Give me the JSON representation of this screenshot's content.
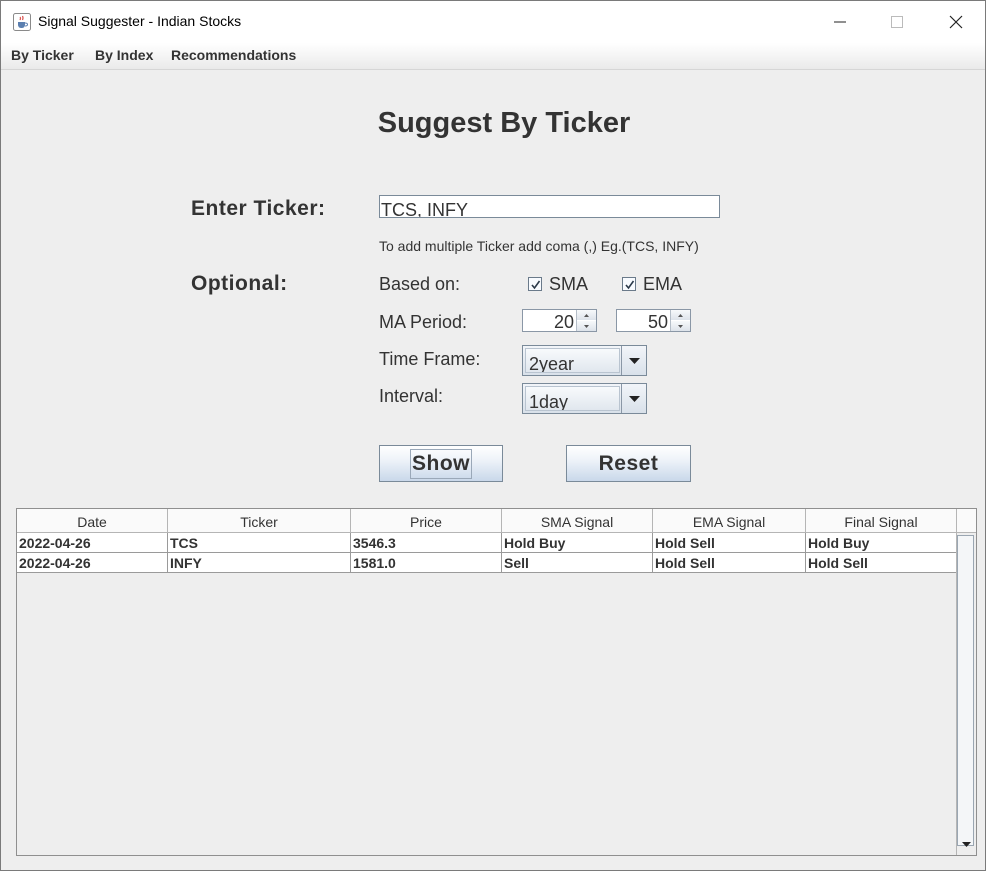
{
  "window": {
    "title": "Signal Suggester - Indian Stocks",
    "icon": "java-cup-icon"
  },
  "menu": [
    "By Ticker",
    "By Index",
    "Recommendations"
  ],
  "main": {
    "heading": "Suggest By Ticker",
    "ticker_label": "Enter Ticker:",
    "ticker_value": "TCS, INFY",
    "hint": "To add multiple Ticker add coma (,) Eg.(TCS, INFY)",
    "optional_label": "Optional:",
    "based_on_label": "Based on:",
    "sma": {
      "label": "SMA",
      "checked": true
    },
    "ema": {
      "label": "EMA",
      "checked": true
    },
    "ma_period_label": "MA Period:",
    "ma_period_short": "20",
    "ma_period_long": "50",
    "time_frame_label": "Time Frame:",
    "time_frame_value": "2year",
    "interval_label": "Interval:",
    "interval_value": "1day",
    "show_label": "Show",
    "reset_label": "Reset"
  },
  "table": {
    "columns": [
      "Date",
      "Ticker",
      "Price",
      "SMA Signal",
      "EMA Signal",
      "Final Signal"
    ],
    "rows": [
      [
        "2022-04-26",
        "TCS",
        "3546.3",
        "Hold Buy",
        "Hold Sell",
        "Hold Buy"
      ],
      [
        "2022-04-26",
        "INFY",
        "1581.0",
        "Sell",
        "Hold Sell",
        "Hold Sell"
      ]
    ]
  },
  "colors": {
    "background": "#eeeeee",
    "button_gradient_bottom": "#c9d8ea",
    "text": "#333333"
  }
}
